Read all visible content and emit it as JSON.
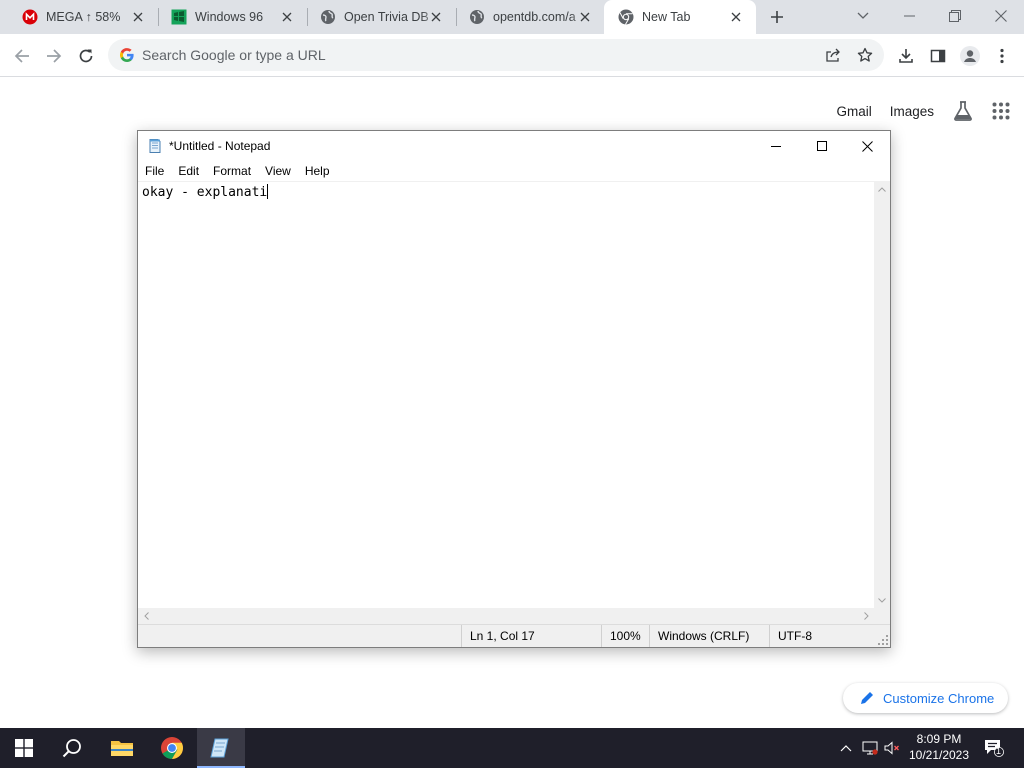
{
  "browser": {
    "tabs": [
      {
        "title": "MEGA ↑ 58%",
        "icon": "mega-icon"
      },
      {
        "title": "Windows 96",
        "icon": "windows96-icon"
      },
      {
        "title": "Open Trivia DB",
        "icon": "globe-icon"
      },
      {
        "title": "opentdb.com/a",
        "icon": "globe-icon"
      },
      {
        "title": "New Tab",
        "icon": "chrome-icon",
        "active": true
      }
    ],
    "omnibox_placeholder": "Search Google or type a URL",
    "ntp": {
      "gmail": "Gmail",
      "images": "Images",
      "customize": "Customize Chrome"
    }
  },
  "notepad": {
    "title": "*Untitled - Notepad",
    "menu": [
      "File",
      "Edit",
      "Format",
      "View",
      "Help"
    ],
    "content": "okay - explanati",
    "status": {
      "position": "Ln 1, Col 17",
      "zoom": "100%",
      "line_endings": "Windows (CRLF)",
      "encoding": "UTF-8"
    }
  },
  "taskbar": {
    "time": "8:09 PM",
    "date": "10/21/2023",
    "notifications": "1"
  },
  "colors": {
    "tabstrip": "#dee1e6",
    "omnibox": "#f1f3f4",
    "link_blue": "#1a73e8",
    "taskbar": "#1f1f2a",
    "mega_red": "#d90007"
  }
}
